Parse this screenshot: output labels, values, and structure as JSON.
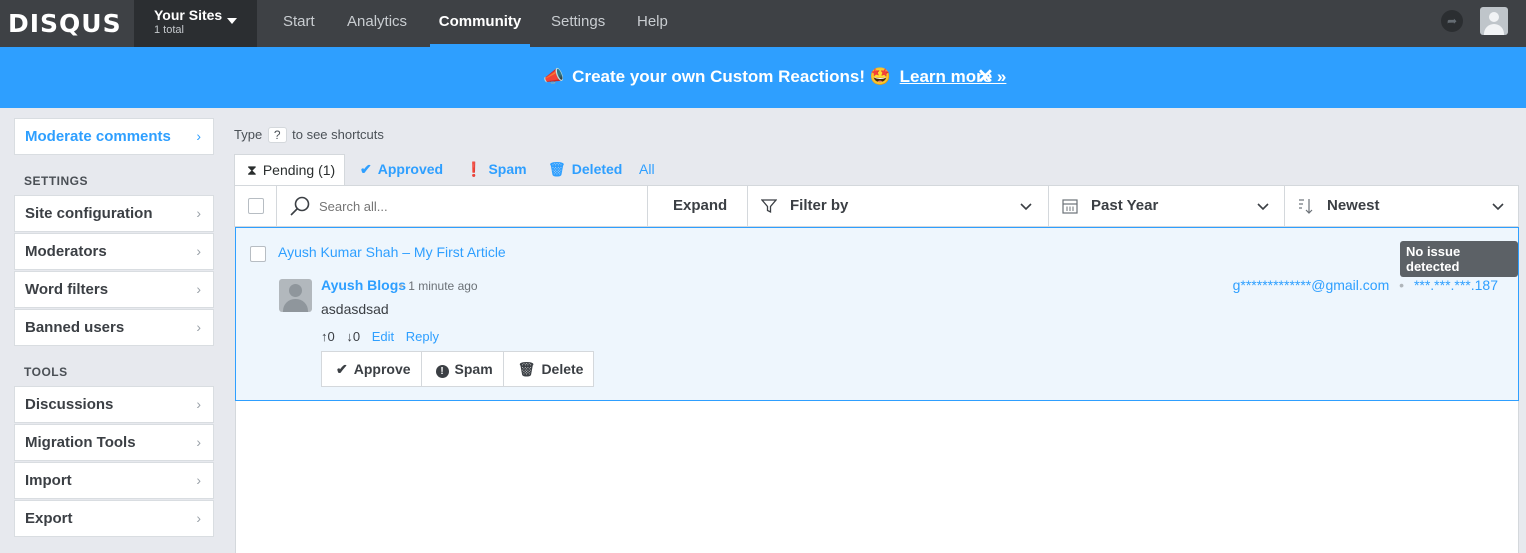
{
  "topbar": {
    "logo": "DISQUS",
    "sites_title": "Your Sites",
    "sites_count": "1 total",
    "nav": [
      "Start",
      "Analytics",
      "Community",
      "Settings",
      "Help"
    ],
    "active_nav": "Community"
  },
  "banner": {
    "text": "Create your own Custom Reactions! 🤩",
    "link": "Learn more »",
    "close": "✕"
  },
  "sidebar": {
    "moderate": "Moderate comments",
    "settings_heading": "SETTINGS",
    "settings_items": [
      "Site configuration",
      "Moderators",
      "Word filters",
      "Banned users"
    ],
    "tools_heading": "TOOLS",
    "tools_items": [
      "Discussions",
      "Migration Tools",
      "Import",
      "Export"
    ]
  },
  "main": {
    "shortcuts_pre": "Type",
    "shortcuts_key": "?",
    "shortcuts_post": "to see shortcuts",
    "tabs": [
      "Pending (1)",
      "Approved",
      "Spam",
      "Deleted",
      "All"
    ],
    "search_placeholder": "Search all...",
    "expand": "Expand",
    "filter": "Filter by",
    "period": "Past Year",
    "sort": "Newest"
  },
  "comment": {
    "thread": "Ayush Kumar Shah – My First Article",
    "badge": "No issue detected",
    "author": "Ayush Blogs",
    "time": "1 minute ago",
    "text": "asdasdsad",
    "email": "g*************@gmail.com",
    "ip": "***.***.***.187",
    "upvotes": "0",
    "downvotes": "0",
    "edit": "Edit",
    "reply": "Reply",
    "approve": "Approve",
    "spam": "Spam",
    "delete": "Delete"
  },
  "colors": {
    "accent": "#2e9fff",
    "topbar": "#3e4145"
  }
}
